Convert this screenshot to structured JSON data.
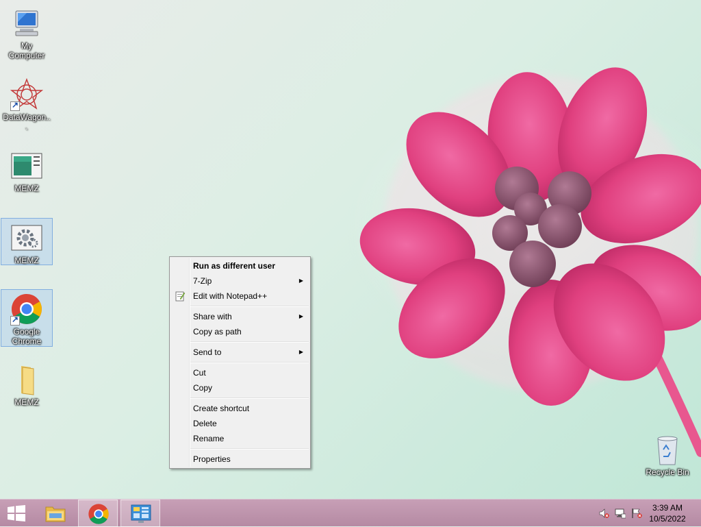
{
  "desktop": {
    "icons": [
      {
        "label": "My Computer",
        "icon": "computer-icon"
      },
      {
        "label": "DataWagon...",
        "icon": "datawagon-icon"
      },
      {
        "label": "MEMZ",
        "icon": "window-app-icon"
      },
      {
        "label": "MEMZ",
        "icon": "gear-settings-icon"
      },
      {
        "label": "Google Chrome",
        "icon": "chrome-icon"
      },
      {
        "label": "MEMZ",
        "icon": "folder-icon"
      },
      {
        "label": "Recycle Bin",
        "icon": "recycle-bin-icon"
      }
    ]
  },
  "context_menu": {
    "items": [
      {
        "label": "Run as different user",
        "bold": true
      },
      {
        "label": "7-Zip",
        "submenu": true
      },
      {
        "label": "Edit with Notepad++",
        "icon": "notepad-plus-plus-icon"
      },
      {
        "label": "Share with",
        "submenu": true
      },
      {
        "label": "Copy as path"
      },
      {
        "label": "Send to",
        "submenu": true
      },
      {
        "label": "Cut"
      },
      {
        "label": "Copy"
      },
      {
        "label": "Create shortcut"
      },
      {
        "label": "Delete"
      },
      {
        "label": "Rename"
      },
      {
        "label": "Properties"
      }
    ],
    "submenu_arrow": "▶"
  },
  "taskbar": {
    "start_icon": "windows-logo-icon",
    "apps": [
      {
        "name": "File Explorer",
        "icon": "file-explorer-icon"
      },
      {
        "name": "Google Chrome",
        "icon": "chrome-icon"
      },
      {
        "name": "Control Panel",
        "icon": "control-panel-icon",
        "active": true
      }
    ],
    "tray": [
      "volume-muted-icon",
      "network-icon",
      "action-center-flag-icon"
    ],
    "clock": {
      "time": "3:39 AM",
      "date": "10/5/2022"
    }
  },
  "colors": {
    "taskbar": "#b58aa3",
    "flower": "#e0407f",
    "selection": "#aacdf0"
  }
}
